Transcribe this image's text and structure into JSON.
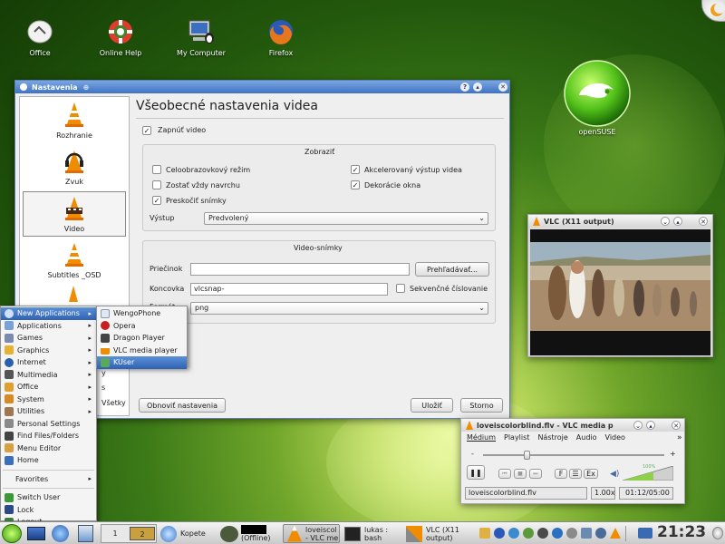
{
  "desktop": {
    "icons": [
      {
        "label": "Office",
        "icon": "office-icon"
      },
      {
        "label": "Online Help",
        "icon": "lifebuoy-icon"
      },
      {
        "label": "My Computer",
        "icon": "computer-icon"
      },
      {
        "label": "Firefox",
        "icon": "firefox-icon"
      }
    ],
    "opensuse_label": "openSUSE"
  },
  "settings": {
    "title": "Nastavenia",
    "heading": "Všeobecné nastavenia videa",
    "sidebar": [
      {
        "label": "Rozhranie"
      },
      {
        "label": "Zvuk"
      },
      {
        "label": "Video"
      },
      {
        "label": "Subtitles _OSD"
      }
    ],
    "sidebar_partial_1": "y",
    "sidebar_partial_2": "s",
    "sidebar_partial_3": "Všetky",
    "enable_video": "Zapnúť video",
    "display_group": "Zobraziť",
    "fullscreen": "Celoobrazovkový režim",
    "on_top": "Zostať vždy navrchu",
    "skip_frames": "Preskočiť snímky",
    "accelerated": "Akcelerovaný výstup videa",
    "decorations": "Dekorácie okna",
    "output_label": "Výstup",
    "output_value": "Predvolený",
    "snapshots_group": "Video-snímky",
    "dir_label": "Priečinok",
    "dir_value": "",
    "browse": "Prehľadávať...",
    "prefix_label": "Koncovka",
    "prefix_value": "vlcsnap-",
    "sequential": "Sekvenčné číslovanie",
    "format_label": "Formát",
    "format_value": "png",
    "reset": "Obnoviť nastavenia",
    "save": "Uložiť",
    "cancel": "Storno"
  },
  "x11": {
    "title": "VLC (X11 output)"
  },
  "vlc": {
    "title": "loveiscolorblind.flv - VLC media p",
    "menu": [
      "Médium",
      "Playlist",
      "Nástroje",
      "Audio",
      "Video"
    ],
    "more": "»",
    "minus": "-",
    "plus": "+",
    "file": "loveiscolorblind.flv",
    "speed": "1.00x",
    "time": "01:12/05:00",
    "btn_f": "F",
    "btn_ex": "Ex",
    "volume": "100%",
    "seek_fraction": 0.24
  },
  "kickoff": {
    "items": [
      {
        "label": "New Applications",
        "sub": true,
        "selected": true
      },
      {
        "label": "Applications",
        "sub": true
      },
      {
        "label": "Games",
        "sub": true
      },
      {
        "label": "Graphics",
        "sub": true
      },
      {
        "label": "Internet",
        "sub": true
      },
      {
        "label": "Multimedia",
        "sub": true
      },
      {
        "label": "Office",
        "sub": true
      },
      {
        "label": "System",
        "sub": true
      },
      {
        "label": "Utilities",
        "sub": true
      },
      {
        "label": "Personal Settings",
        "sub": false
      },
      {
        "label": "Find Files/Folders",
        "sub": false
      },
      {
        "label": "Menu Editor",
        "sub": false
      },
      {
        "label": "Home",
        "sub": false
      }
    ],
    "favorites": "Favorites",
    "bottom": [
      {
        "label": "Switch User"
      },
      {
        "label": "Lock"
      },
      {
        "label": "Logout"
      }
    ],
    "submenu": [
      {
        "label": "WengoPhone"
      },
      {
        "label": "Opera"
      },
      {
        "label": "Dragon Player"
      },
      {
        "label": "VLC media player"
      },
      {
        "label": "KUser",
        "selected": true
      }
    ]
  },
  "panel": {
    "desktop_1": "1",
    "desktop_2": "2",
    "tasks": [
      {
        "label": "Kopete"
      },
      {
        "label": "(Offline)"
      },
      {
        "label": "loveiscol\n- VLC me"
      },
      {
        "label": "lukas :\nbash"
      },
      {
        "label": "VLC (X11\noutput)"
      }
    ],
    "clock": "21:23"
  },
  "colors": {
    "accent": "#3f72c4",
    "selection": "#2f63b3",
    "desktop_green": "#3c7a18"
  }
}
